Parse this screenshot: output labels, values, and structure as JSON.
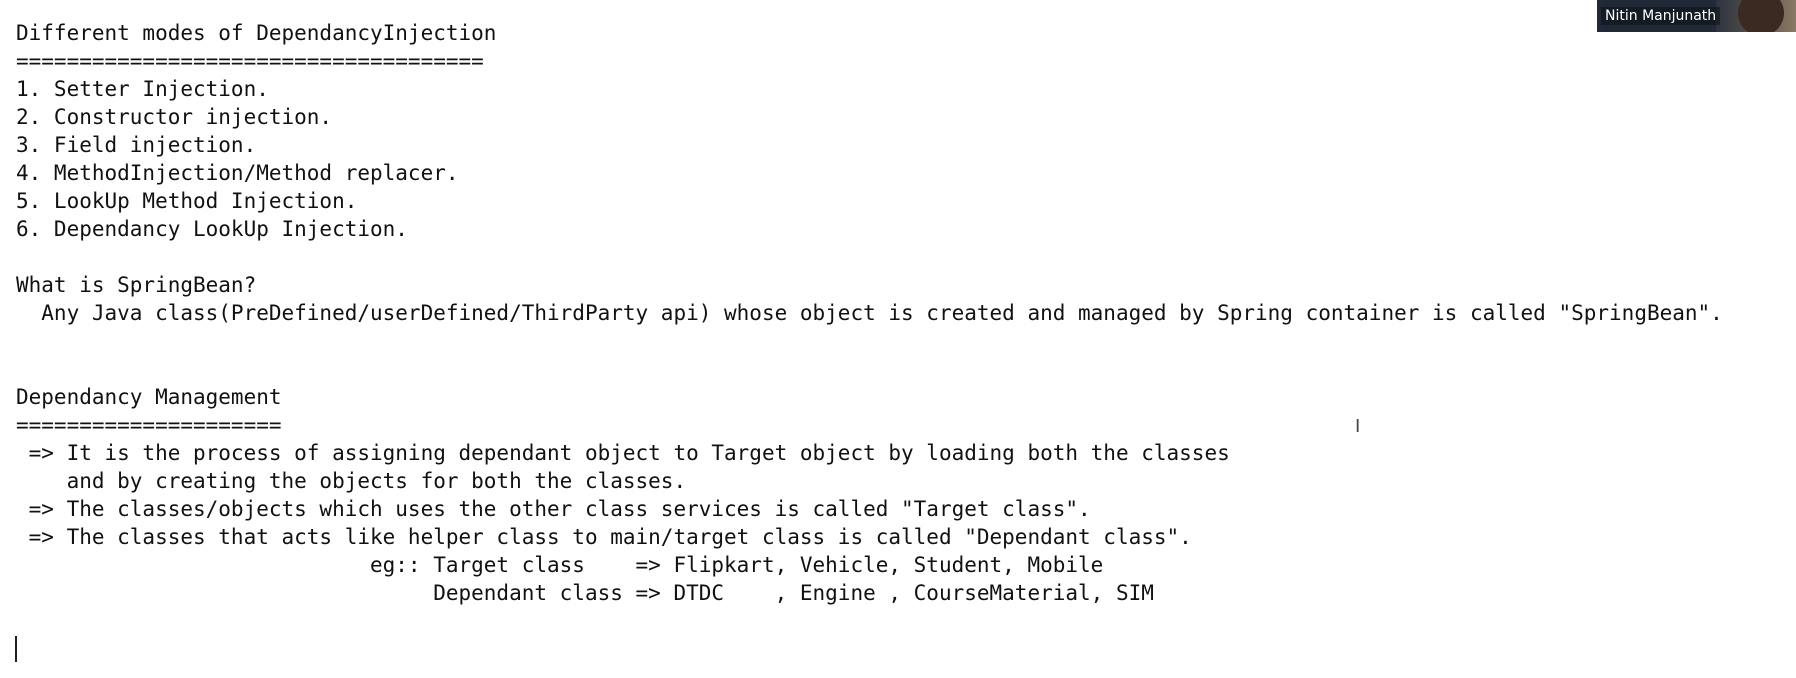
{
  "document": {
    "lines": [
      "Different modes of DependancyInjection",
      "=====================================",
      "1. Setter Injection.",
      "2. Constructor injection.",
      "3. Field injection.",
      "4. MethodInjection/Method replacer.",
      "5. LookUp Method Injection.",
      "6. Dependancy LookUp Injection.",
      "",
      "What is SpringBean?",
      "  Any Java class(PreDefined/userDefined/ThirdParty api) whose object is created and managed by Spring container is called \"SpringBean\".",
      "",
      "",
      "Dependancy Management",
      "=====================",
      " => It is the process of assigning dependant object to Target object by loading both the classes",
      "    and by creating the objects for both the classes.",
      " => The classes/objects which uses the other class services is called \"Target class\".",
      " => The classes that acts like helper class to main/target class is called \"Dependant class\".",
      "                            eg:: Target class    => Flipkart, Vehicle, Student, Mobile",
      "                                 Dependant class => DTDC    , Engine , CourseMaterial, SIM"
    ]
  },
  "video_call": {
    "participant_name": "Nitin Manjunath"
  },
  "icons": {
    "cursor": "text-cursor-icon"
  }
}
